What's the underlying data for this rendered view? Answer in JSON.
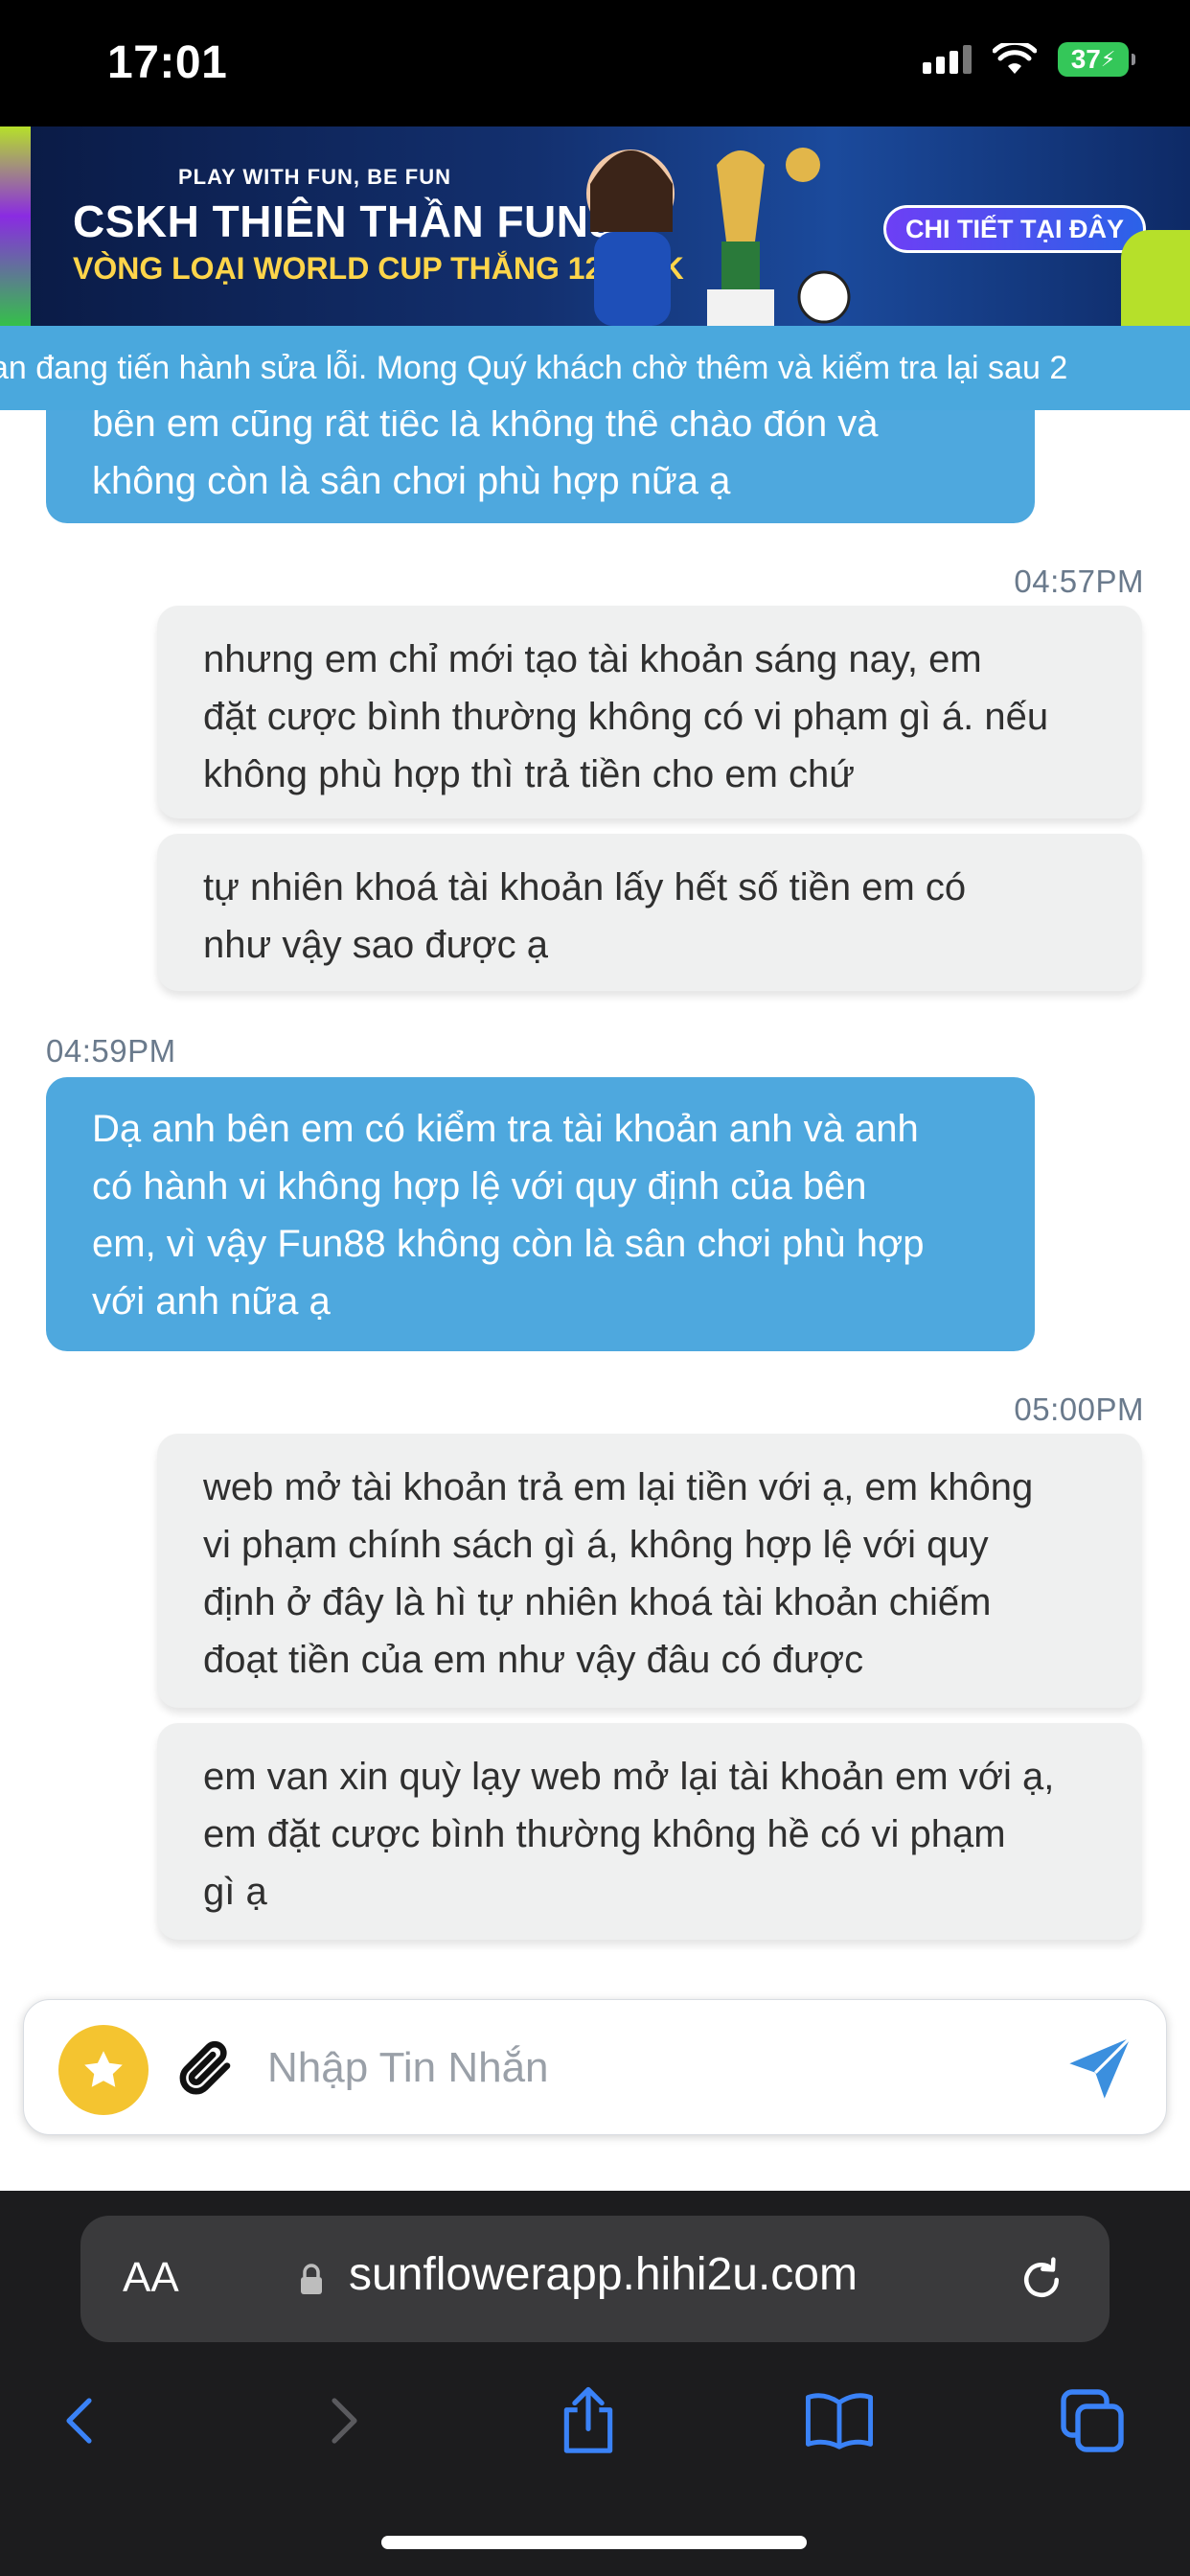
{
  "status_bar": {
    "time": "17:01",
    "battery": "37"
  },
  "banner": {
    "tagline": "PLAY WITH FUN, BE FUN",
    "title": "CSKH THIÊN THẦN FUN88",
    "subtitle": "VÒNG LOẠI WORLD CUP THẮNG 12,632K",
    "cta": "CHI TIẾT TẠI ĐÂY"
  },
  "marquee": {
    "text": "an đang tiến hành sửa lỗi. Mong Quý khách chờ thêm và kiểm tra lại sau 2"
  },
  "messages": [
    {
      "role": "agent",
      "lines": [
        "bên em cũng rất tiếc là không thể chào đón và",
        "không còn là sân chơi phù hợp nữa ạ"
      ]
    },
    {
      "role": "timestamp",
      "text": "04:57PM",
      "align": "right"
    },
    {
      "role": "user",
      "lines": [
        "nhưng em chỉ mới tạo tài khoản sáng nay, em",
        "đặt cược bình thường không có vi phạm gì á. nếu",
        "không phù hợp thì trả tiền cho em chứ"
      ]
    },
    {
      "role": "user",
      "lines": [
        "tự nhiên khoá tài khoản lấy hết số tiền em có",
        "như vậy sao được ạ"
      ]
    },
    {
      "role": "timestamp",
      "text": "04:59PM",
      "align": "left"
    },
    {
      "role": "agent",
      "lines": [
        "Dạ anh bên em có kiểm tra tài khoản anh và anh",
        "có hành vi không hợp lệ với quy định của bên",
        "em, vì vậy Fun88 không còn là sân chơi phù hợp",
        "với anh nữa ạ"
      ]
    },
    {
      "role": "timestamp",
      "text": "05:00PM",
      "align": "right"
    },
    {
      "role": "user",
      "lines": [
        "web mở tài khoản trả em lại tiền với ạ, em không",
        "vi phạm chính sách gì á, không hợp lệ với quy",
        "định ở đây là hì tự nhiên khoá tài khoản chiếm",
        "đoạt tiền của em như vậy đâu có được"
      ]
    },
    {
      "role": "user",
      "lines": [
        "em van xin quỳ lạy web mở lại tài khoản em với ạ,",
        "em đặt cược bình thường không hề có vi phạm",
        "gì ạ"
      ]
    }
  ],
  "composer": {
    "placeholder": "Nhập Tin Nhắn",
    "value": ""
  },
  "browser": {
    "text_size_label": "AA",
    "url": "sunflowerapp.hihi2u.com"
  },
  "icons": {
    "favorite": "star-icon",
    "attach": "paperclip-icon",
    "send": "send-icon",
    "lock": "lock-icon",
    "reload": "reload-icon",
    "back": "chevron-left-icon",
    "forward": "chevron-right-icon",
    "share": "share-icon",
    "bookmarks": "book-icon",
    "tabs": "tabs-icon"
  },
  "colors": {
    "agent_bubble": "#4ea8de",
    "user_bubble": "#eff0f0",
    "banner_bg": "#13306f",
    "marquee_bg": "#4aa8dd",
    "favorite_button": "#f4c430",
    "send_button": "#3b8fde",
    "browser_link": "#3a82f7"
  }
}
